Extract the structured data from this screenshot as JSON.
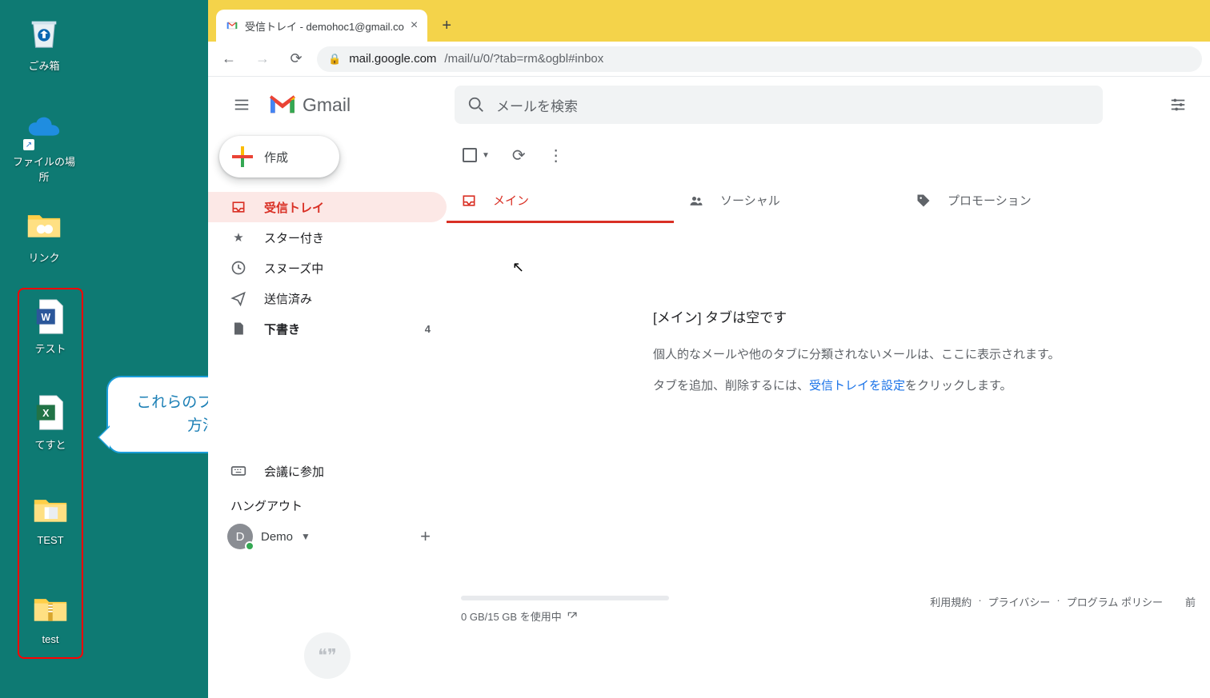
{
  "desktop": {
    "trash": "ごみ箱",
    "filesloc": "ファイルの場所",
    "links": "リンク",
    "word": "テスト",
    "excel": "てすと",
    "folder": "TEST",
    "zip": "test"
  },
  "callout": {
    "line1": "これらのファイルをGmailに添付する",
    "line2": "方法をご説明します。"
  },
  "browser": {
    "tab_title": "受信トレイ - demohoc1@gmail.co",
    "url_host": "mail.google.com",
    "url_path": "/mail/u/0/?tab=rm&ogbl#inbox"
  },
  "gmail": {
    "brand": "Gmail",
    "search_placeholder": "メールを検索",
    "compose": "作成",
    "nav": {
      "inbox": "受信トレイ",
      "starred": "スター付き",
      "snoozed": "スヌーズ中",
      "sent": "送信済み",
      "drafts": "下書き",
      "drafts_count": "4",
      "join_meeting": "会議に参加"
    },
    "hangout": {
      "header": "ハングアウト",
      "name": "Demo",
      "initial": "D"
    },
    "tabs": {
      "primary": "メイン",
      "social": "ソーシャル",
      "promotions": "プロモーション"
    },
    "empty": {
      "title": "[メイン] タブは空です",
      "line1": "個人的なメールや他のタブに分類されないメールは、ここに表示されます。",
      "line2a": "タブを追加、削除するには、",
      "line2link": "受信トレイを設定",
      "line2b": "をクリックします。"
    },
    "footer": {
      "usage": "0 GB/15 GB を使用中",
      "terms": "利用規約",
      "privacy": "プライバシー",
      "policies": "プログラム ポリシー",
      "last": "前"
    }
  }
}
